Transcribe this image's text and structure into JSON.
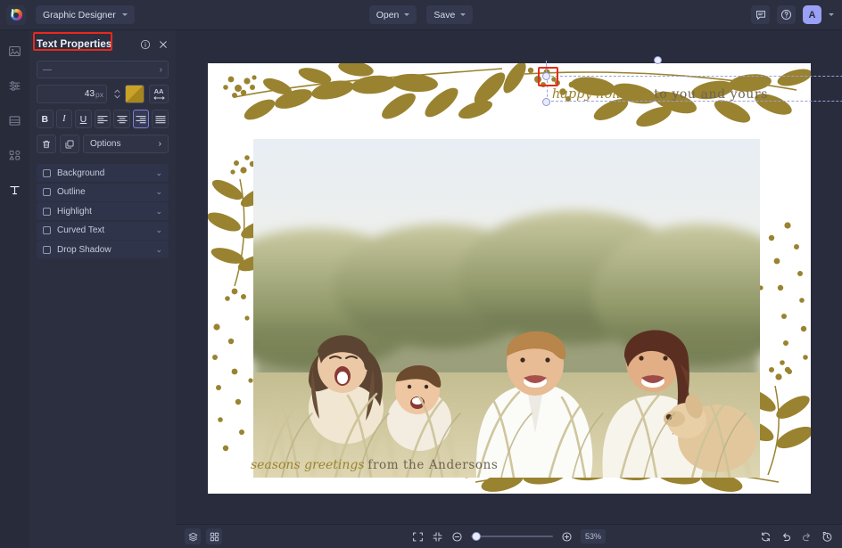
{
  "topbar": {
    "logo_icon": "colorwheel-logo-icon",
    "document_name": "Graphic Designer",
    "open_label": "Open",
    "save_label": "Save",
    "comment_icon": "comment-icon",
    "help_icon": "help-circle-icon",
    "avatar_initial": "A",
    "avatar_color": "#9aa0f5"
  },
  "rail": {
    "items": [
      {
        "name": "sidebar-item-image",
        "icon": "image-icon",
        "active": false
      },
      {
        "name": "sidebar-item-adjust",
        "icon": "sliders-icon",
        "active": false
      },
      {
        "name": "sidebar-item-layout",
        "icon": "layout-icon",
        "active": false
      },
      {
        "name": "sidebar-item-elements",
        "icon": "shapes-icon",
        "active": false
      },
      {
        "name": "sidebar-item-text",
        "icon": "text-t-icon",
        "active": true
      }
    ]
  },
  "panel": {
    "title": "Text Properties",
    "title_highlight_color": "#e8291c",
    "info_icon": "info-icon",
    "close_icon": "close-icon",
    "font_family_value": "—",
    "font_size_value": "43",
    "font_size_unit": "px",
    "color_swatch": "#c9a227",
    "letter_spacing_icon": "letter-spacing-aa-icon",
    "bold_label": "B",
    "italic_label": "I",
    "underline_label": "U",
    "align_left_icon": "align-left-icon",
    "align_center_icon": "align-center-icon",
    "align_right_icon": "align-right-icon",
    "align_justify_icon": "align-justify-icon",
    "selected_align": "align-right",
    "delete_icon": "trash-icon",
    "duplicate_icon": "duplicate-icon",
    "options_label": "Options",
    "accordions": [
      {
        "label": "Background",
        "checked": false
      },
      {
        "label": "Outline",
        "checked": false
      },
      {
        "label": "Highlight",
        "checked": false
      },
      {
        "label": "Curved Text",
        "checked": false
      },
      {
        "label": "Drop Shadow",
        "checked": false
      }
    ]
  },
  "canvas": {
    "card_background": "#ffffff",
    "accent_gold": "#9a8330",
    "greeting_top": {
      "script": "happy holidays",
      "serif": "to you and yours"
    },
    "greeting_bottom": {
      "script": "seasons greetings",
      "serif": "from the Andersons"
    },
    "selection_handle_highlight_color": "#e8291c"
  },
  "bottombar": {
    "layers_icon": "layers-icon",
    "grid_icon": "grid-icon",
    "fit_screen_icon": "fit-screen-icon",
    "actual_size_icon": "collapse-screen-icon",
    "zoom_out_icon": "zoom-out-icon",
    "zoom_in_icon": "zoom-in-icon",
    "zoom_value": "53%",
    "zoom_slider_percent": 12,
    "reset_icon": "refresh-icon",
    "undo_icon": "undo-icon",
    "redo_icon": "redo-icon",
    "history_icon": "history-icon"
  }
}
